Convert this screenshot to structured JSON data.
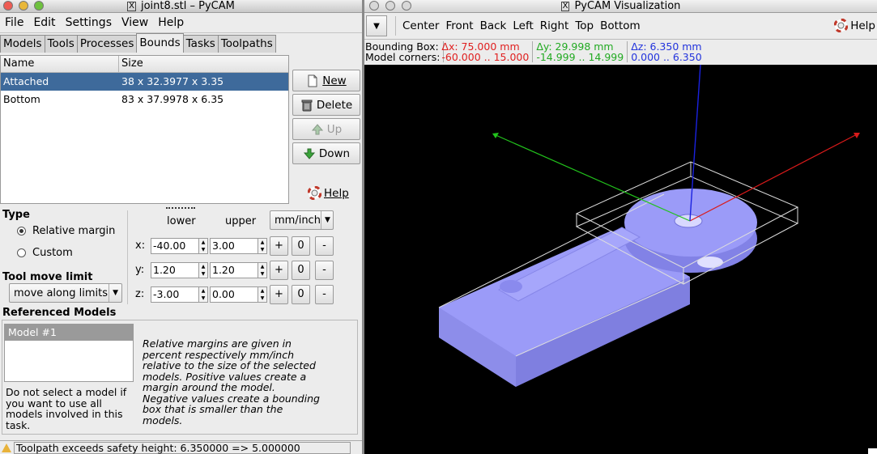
{
  "left_window": {
    "title": "joint8.stl – PyCAM",
    "menu": [
      "File",
      "Edit",
      "Settings",
      "View",
      "Help"
    ],
    "tabs": [
      "Models",
      "Tools",
      "Processes",
      "Bounds",
      "Tasks",
      "Toolpaths"
    ],
    "active_tab": "Bounds",
    "table": {
      "columns": [
        "Name",
        "Size"
      ],
      "rows": [
        {
          "name": "Attached",
          "size": "38 x 32.3977 x 3.35",
          "selected": true
        },
        {
          "name": "Bottom",
          "size": "83 x 37.9978 x 6.35",
          "selected": false
        }
      ]
    },
    "buttons": {
      "new": "New",
      "delete": "Delete",
      "up": "Up",
      "down": "Down",
      "help": "Help"
    },
    "type": {
      "label": "Type",
      "options": [
        "Relative margin",
        "Custom"
      ],
      "selected": "Relative margin"
    },
    "margins": {
      "lower_label": "lower",
      "upper_label": "upper",
      "unit": "mm/inch",
      "rows": [
        {
          "axis": "x:",
          "lower": "-40.00",
          "upper": "3.00"
        },
        {
          "axis": "y:",
          "lower": "1.20",
          "upper": "1.20"
        },
        {
          "axis": "z:",
          "lower": "-3.00",
          "upper": "0.00"
        }
      ],
      "btn_plus": "+",
      "btn_zero": "0",
      "btn_minus": "-"
    },
    "tool_move": {
      "label": "Tool move limit",
      "value": "move along limits"
    },
    "referenced": {
      "label": "Referenced Models",
      "models": [
        "Model #1"
      ],
      "hint": "Do not select a model if you want to use all models involved in this task.",
      "description": "Relative margins are given in percent respectively mm/inch relative to the size of the selected models. Positive values create a margin around the model. Negative values create a bounding box that is smaller than the models."
    },
    "status": "Toolpath exceeds safety height: 6.350000 => 5.000000"
  },
  "right_window": {
    "title": "PyCAM Visualization",
    "views": [
      "Center",
      "Front",
      "Back",
      "Left",
      "Right",
      "Top",
      "Bottom"
    ],
    "help": "Help",
    "bbox": {
      "label": "Bounding Box:",
      "dx": "Δx: 75.000 mm",
      "dy": "Δy: 29.998 mm",
      "dz": "Δz: 6.350 mm"
    },
    "corners": {
      "label": "Model corners:",
      "x": "-60.000 .. 15.000",
      "y": "-14.999 .. 14.999",
      "z": "0.000 .. 6.350"
    },
    "colors": {
      "x_axis": "#d91a1a",
      "y_axis": "#22c31c",
      "z_axis": "#1a22e0",
      "model": "#9b9bf8"
    }
  }
}
